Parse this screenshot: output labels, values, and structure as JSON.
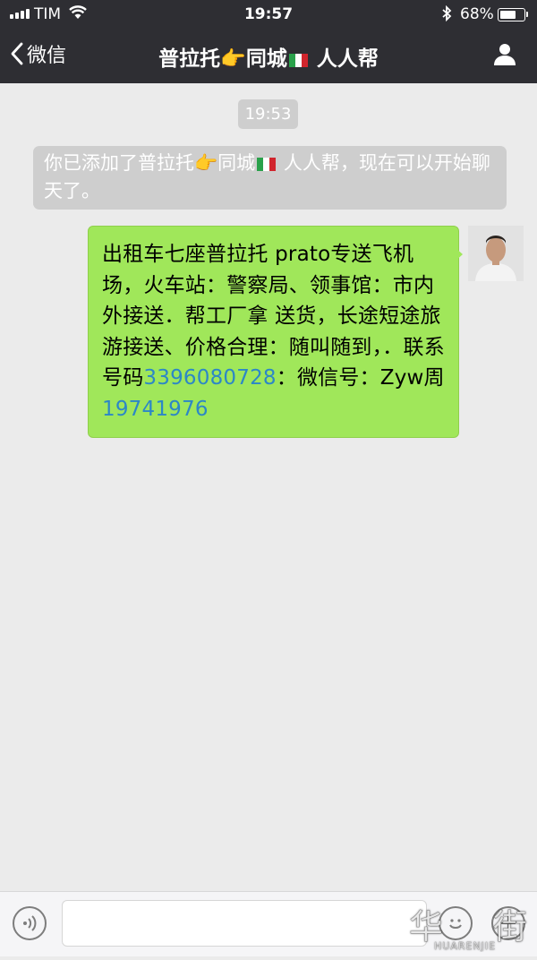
{
  "status_bar": {
    "carrier": "TIM",
    "time": "19:57",
    "battery": "68%",
    "battery_level": 0.68
  },
  "nav": {
    "back_label": "微信",
    "title_part1": "普拉托",
    "title_emoji": "👉",
    "title_part2": "同城",
    "title_part3": " 人人帮"
  },
  "chat": {
    "timestamp": "19:53",
    "system_message": {
      "part1": "你已添加了普拉托",
      "emoji": "👉",
      "part2": "同城",
      "part3": " 人人帮，现在可以开始聊天了。"
    },
    "message": {
      "text1": "出租车七座普拉托 prato专送飞机场，火车站：警察局、领事馆：市内外接送．帮工厂拿 送货，长途短途旅游接送、价格合理：随叫随到，．联系号码",
      "phone1": "3396080728",
      "text2": "：微信号：Zyw周",
      "phone2": "19741976"
    }
  },
  "watermark": {
    "text": "华",
    "subtext": "HUARENJIE"
  },
  "colors": {
    "bubble": "#a0e75a",
    "link": "#2c87c7",
    "nav_bg": "#2e2e33",
    "chat_bg": "#ebebeb"
  },
  "icons": [
    "signal-icon",
    "wifi-icon",
    "bluetooth-icon",
    "battery-icon",
    "back-chevron-icon",
    "italy-flag-icon",
    "user-icon",
    "voice-icon",
    "emoji-icon",
    "plus-icon"
  ]
}
